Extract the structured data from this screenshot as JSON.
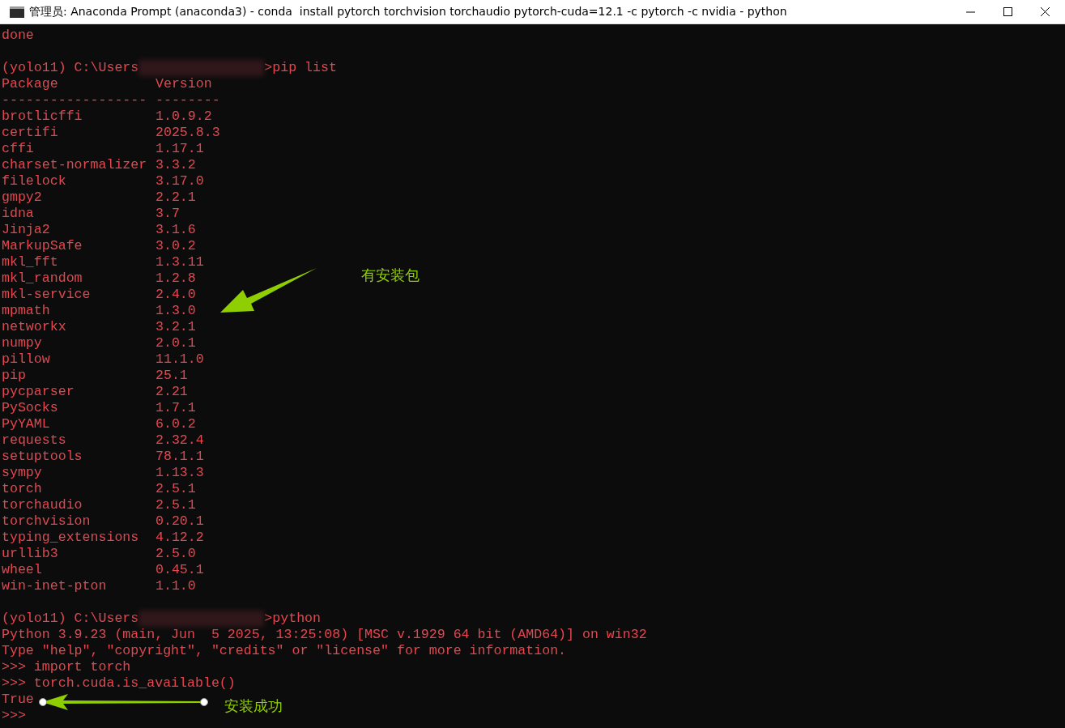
{
  "window": {
    "title": "管理员: Anaconda Prompt (anaconda3) - conda  install pytorch torchvision torchaudio pytorch-cuda=12.1 -c pytorch -c nvidia - python"
  },
  "terminal": {
    "lines": [
      {
        "kind": "text",
        "text": "done"
      },
      {
        "kind": "blank"
      },
      {
        "kind": "prompt",
        "prefix": "(yolo11) C:\\Users",
        "command": ">pip list"
      },
      {
        "kind": "package",
        "name": "Package",
        "version": "Version"
      },
      {
        "kind": "package",
        "name": "------------------",
        "version": "--------"
      },
      {
        "kind": "package",
        "name": "brotlicffi",
        "version": "1.0.9.2"
      },
      {
        "kind": "package",
        "name": "certifi",
        "version": "2025.8.3"
      },
      {
        "kind": "package",
        "name": "cffi",
        "version": "1.17.1"
      },
      {
        "kind": "package",
        "name": "charset-normalizer",
        "version": "3.3.2"
      },
      {
        "kind": "package",
        "name": "filelock",
        "version": "3.17.0"
      },
      {
        "kind": "package",
        "name": "gmpy2",
        "version": "2.2.1"
      },
      {
        "kind": "package",
        "name": "idna",
        "version": "3.7"
      },
      {
        "kind": "package",
        "name": "Jinja2",
        "version": "3.1.6"
      },
      {
        "kind": "package",
        "name": "MarkupSafe",
        "version": "3.0.2"
      },
      {
        "kind": "package",
        "name": "mkl_fft",
        "version": "1.3.11"
      },
      {
        "kind": "package",
        "name": "mkl_random",
        "version": "1.2.8"
      },
      {
        "kind": "package",
        "name": "mkl-service",
        "version": "2.4.0"
      },
      {
        "kind": "package",
        "name": "mpmath",
        "version": "1.3.0"
      },
      {
        "kind": "package",
        "name": "networkx",
        "version": "3.2.1"
      },
      {
        "kind": "package",
        "name": "numpy",
        "version": "2.0.1"
      },
      {
        "kind": "package",
        "name": "pillow",
        "version": "11.1.0"
      },
      {
        "kind": "package",
        "name": "pip",
        "version": "25.1"
      },
      {
        "kind": "package",
        "name": "pycparser",
        "version": "2.21"
      },
      {
        "kind": "package",
        "name": "PySocks",
        "version": "1.7.1"
      },
      {
        "kind": "package",
        "name": "PyYAML",
        "version": "6.0.2"
      },
      {
        "kind": "package",
        "name": "requests",
        "version": "2.32.4"
      },
      {
        "kind": "package",
        "name": "setuptools",
        "version": "78.1.1"
      },
      {
        "kind": "package",
        "name": "sympy",
        "version": "1.13.3"
      },
      {
        "kind": "package",
        "name": "torch",
        "version": "2.5.1"
      },
      {
        "kind": "package",
        "name": "torchaudio",
        "version": "2.5.1"
      },
      {
        "kind": "package",
        "name": "torchvision",
        "version": "0.20.1"
      },
      {
        "kind": "package",
        "name": "typing_extensions",
        "version": "4.12.2"
      },
      {
        "kind": "package",
        "name": "urllib3",
        "version": "2.5.0"
      },
      {
        "kind": "package",
        "name": "wheel",
        "version": "0.45.1"
      },
      {
        "kind": "package",
        "name": "win-inet-pton",
        "version": "1.1.0"
      },
      {
        "kind": "blank"
      },
      {
        "kind": "prompt",
        "prefix": "(yolo11) C:\\Users",
        "command": ">python"
      },
      {
        "kind": "text",
        "text": "Python 3.9.23 (main, Jun  5 2025, 13:25:08) [MSC v.1929 64 bit (AMD64)] on win32"
      },
      {
        "kind": "text",
        "text": "Type \"help\", \"copyright\", \"credits\" or \"license\" for more information."
      },
      {
        "kind": "text",
        "text": ">>> import torch"
      },
      {
        "kind": "text",
        "text": ">>> torch.cuda.is_available()"
      },
      {
        "kind": "text",
        "text": "True"
      },
      {
        "kind": "text",
        "text": ">>>"
      }
    ]
  },
  "annotations": [
    {
      "kind": "slanted",
      "label": "有安装包"
    },
    {
      "kind": "dotted",
      "label": "安装成功"
    }
  ]
}
